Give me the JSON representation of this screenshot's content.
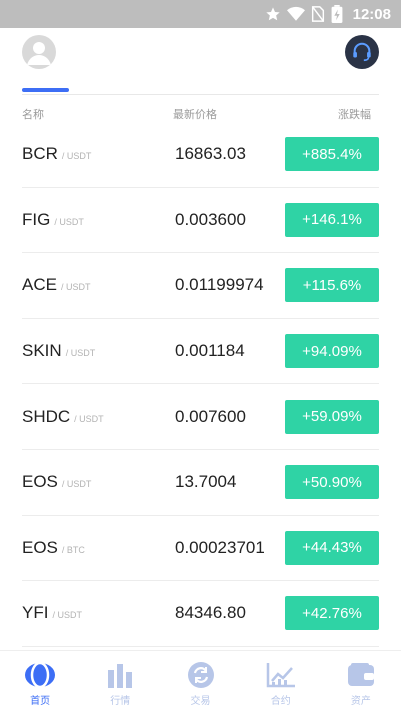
{
  "status_bar": {
    "time": "12:08"
  },
  "columns": {
    "name": "名称",
    "price": "最新价格",
    "change": "涨跌幅"
  },
  "rows": [
    {
      "base": "BCR",
      "quote": "/ USDT",
      "price": "16863.03",
      "change": "+885.4%"
    },
    {
      "base": "FIG",
      "quote": "/ USDT",
      "price": "0.003600",
      "change": "+146.1%"
    },
    {
      "base": "ACE",
      "quote": "/ USDT",
      "price": "0.01199974",
      "change": "+115.6%"
    },
    {
      "base": "SKIN",
      "quote": "/ USDT",
      "price": "0.001184",
      "change": "+94.09%"
    },
    {
      "base": "SHDC",
      "quote": "/ USDT",
      "price": "0.007600",
      "change": "+59.09%"
    },
    {
      "base": "EOS",
      "quote": "/ USDT",
      "price": "13.7004",
      "change": "+50.90%"
    },
    {
      "base": "EOS",
      "quote": "/ BTC",
      "price": "0.00023701",
      "change": "+44.43%"
    },
    {
      "base": "YFI",
      "quote": "/ USDT",
      "price": "84346.80",
      "change": "+42.76%"
    }
  ],
  "nav": [
    {
      "label": "首页",
      "icon": "home-icon"
    },
    {
      "label": "行情",
      "icon": "market-bars-icon"
    },
    {
      "label": "交易",
      "icon": "exchange-icon"
    },
    {
      "label": "合约",
      "icon": "contract-chart-icon"
    },
    {
      "label": "资产",
      "icon": "wallet-icon"
    }
  ],
  "colors": {
    "accent": "#3d6ef5",
    "rise": "#2fd3a5",
    "nav_inactive": "#b7c6e8",
    "status_bar": "#bdbdbd"
  }
}
